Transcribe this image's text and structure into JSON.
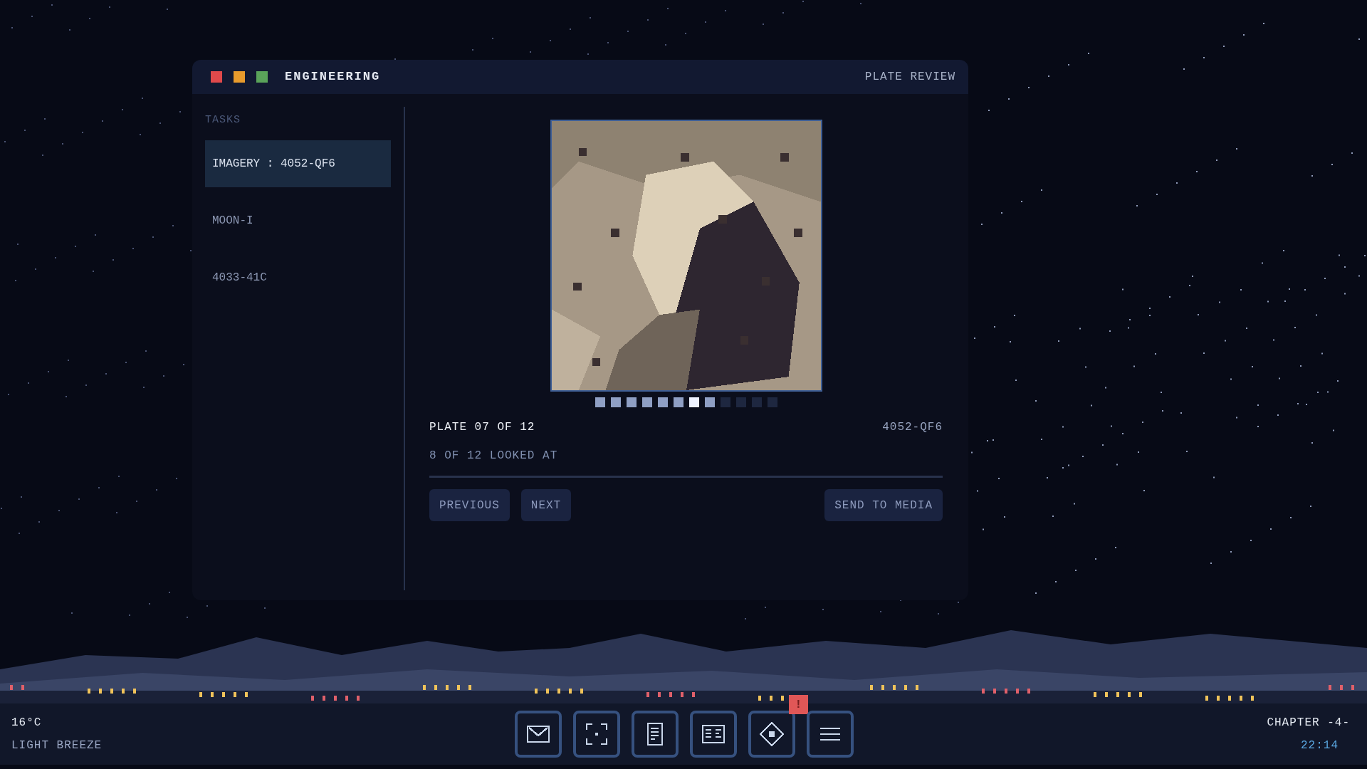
{
  "window": {
    "title": "ENGINEERING",
    "subtitle": "PLATE REVIEW"
  },
  "sidebar": {
    "heading": "TASKS",
    "items": [
      {
        "label": "IMAGERY : 4052-QF6",
        "selected": true
      },
      {
        "label": "MOON-I",
        "selected": false
      },
      {
        "label": "4033-41C",
        "selected": false
      }
    ]
  },
  "plate": {
    "kind": "picture",
    "dots": [
      {
        "viewed": true,
        "selected": false
      },
      {
        "viewed": true,
        "selected": false
      },
      {
        "viewed": true,
        "selected": false
      },
      {
        "viewed": true,
        "selected": false
      },
      {
        "viewed": true,
        "selected": false
      },
      {
        "viewed": true,
        "selected": false
      },
      {
        "viewed": true,
        "selected": true
      },
      {
        "viewed": true,
        "selected": false
      },
      {
        "viewed": false,
        "selected": false
      },
      {
        "viewed": false,
        "selected": false
      },
      {
        "viewed": false,
        "selected": false
      },
      {
        "viewed": false,
        "selected": false
      }
    ],
    "position": "PLATE 07 OF 12",
    "code": "4052-QF6",
    "progress": "8 OF 12 LOOKED AT"
  },
  "buttons": {
    "left": [
      "PREVIOUS",
      "NEXT"
    ],
    "right": "SEND TO MEDIA"
  },
  "status": {
    "temperature": "16°C",
    "weather": "LIGHT BREEZE",
    "chapter": "CHAPTER -4-",
    "time": "22:14"
  },
  "taskbar": [
    {
      "kind": "mail"
    },
    {
      "kind": "focus"
    },
    {
      "kind": "document"
    },
    {
      "kind": "columns"
    },
    {
      "kind": "diamond",
      "badge": "!"
    },
    {
      "kind": "menu"
    }
  ]
}
